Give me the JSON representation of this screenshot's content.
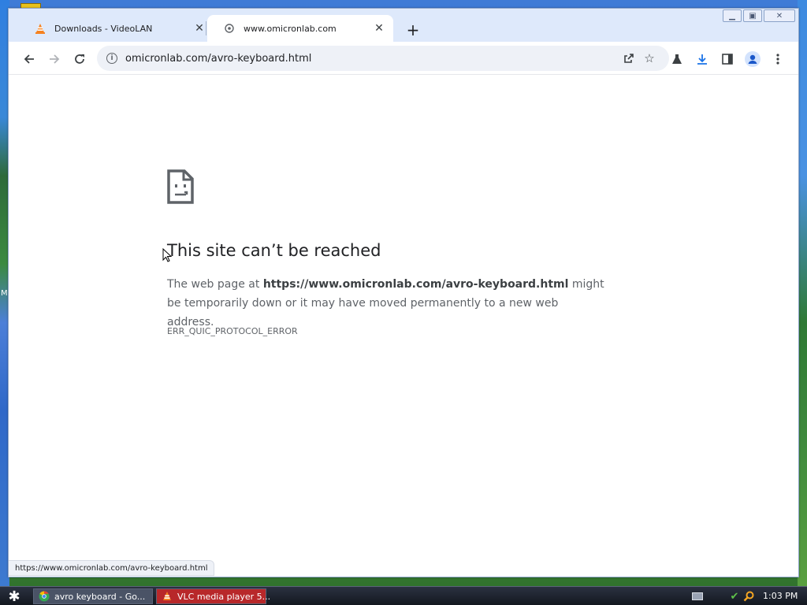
{
  "tabs": [
    {
      "title": "Downloads - VideoLAN",
      "icon": "vlc-cone-icon",
      "active": false
    },
    {
      "title": "www.omicronlab.com",
      "icon": "globe-icon",
      "active": true
    }
  ],
  "toolbar": {
    "url": "omicronlab.com/avro-keyboard.html"
  },
  "error": {
    "title": "This site can’t be reached",
    "body_prefix": "The web page at ",
    "body_url": "https://www.omicronlab.com/avro-keyboard.html",
    "body_suffix": " might be temporarily down or it may have moved permanently to a new web address.",
    "code": "ERR_QUIC_PROTOCOL_ERROR"
  },
  "status_bar": {
    "hover_url": "https://www.omicronlab.com/avro-keyboard.html"
  },
  "taskbar": {
    "items": [
      {
        "label": "avro keyboard - Go...",
        "icon": "chrome-icon"
      },
      {
        "label": "VLC media player 5...",
        "icon": "vlc-cone-icon"
      }
    ],
    "clock": "1:03 PM"
  },
  "desktop": {
    "edge_letter": "M"
  },
  "colors": {
    "titlebar": "#dee9fb",
    "omnibox": "#eef1f7",
    "taskbar": "#141820",
    "vlc_task": "#b8282a",
    "vlc_orange": "#f58220"
  }
}
